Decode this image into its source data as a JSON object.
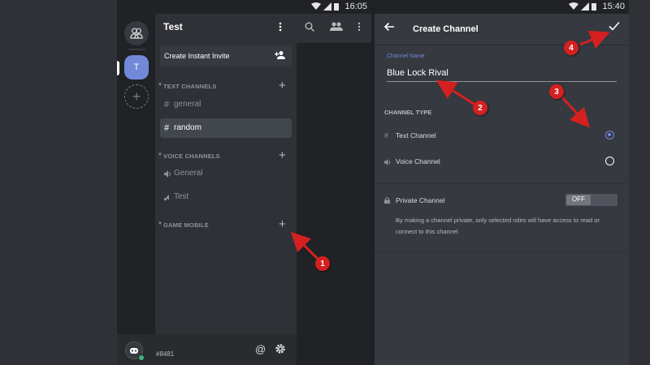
{
  "left_phone": {
    "status_time": "16:05",
    "server_title": "Test",
    "server_initial": "T",
    "invite_label": "Create Instant Invite",
    "categories": [
      {
        "name": "TEXT CHANNELS",
        "channels": [
          {
            "name": "general"
          },
          {
            "name": "random"
          }
        ]
      },
      {
        "name": "VOICE CHANNELS",
        "channels": [
          {
            "name": "General"
          },
          {
            "name": "Test"
          }
        ]
      },
      {
        "name": "GAME MOBILE",
        "channels": []
      }
    ],
    "user_tag": "#8481",
    "at_symbol": "@"
  },
  "right_phone": {
    "status_time": "15:40",
    "title": "Create Channel",
    "field_label": "Channel Name",
    "field_value": "Blue Lock Rival",
    "channel_type_label": "CHANNEL TYPE",
    "text_channel_label": "Text Channel",
    "voice_channel_label": "Voice Channel",
    "selected_type": "text",
    "private_label": "Private Channel",
    "private_toggle": "OFF",
    "private_description": "By making a channel private, only selected roles will have access to read or connect to this channel"
  },
  "annotations": [
    "1",
    "2",
    "3",
    "4"
  ],
  "colors": {
    "accent": "#7289da",
    "annotation_red": "#d42020",
    "online": "#43b581"
  }
}
